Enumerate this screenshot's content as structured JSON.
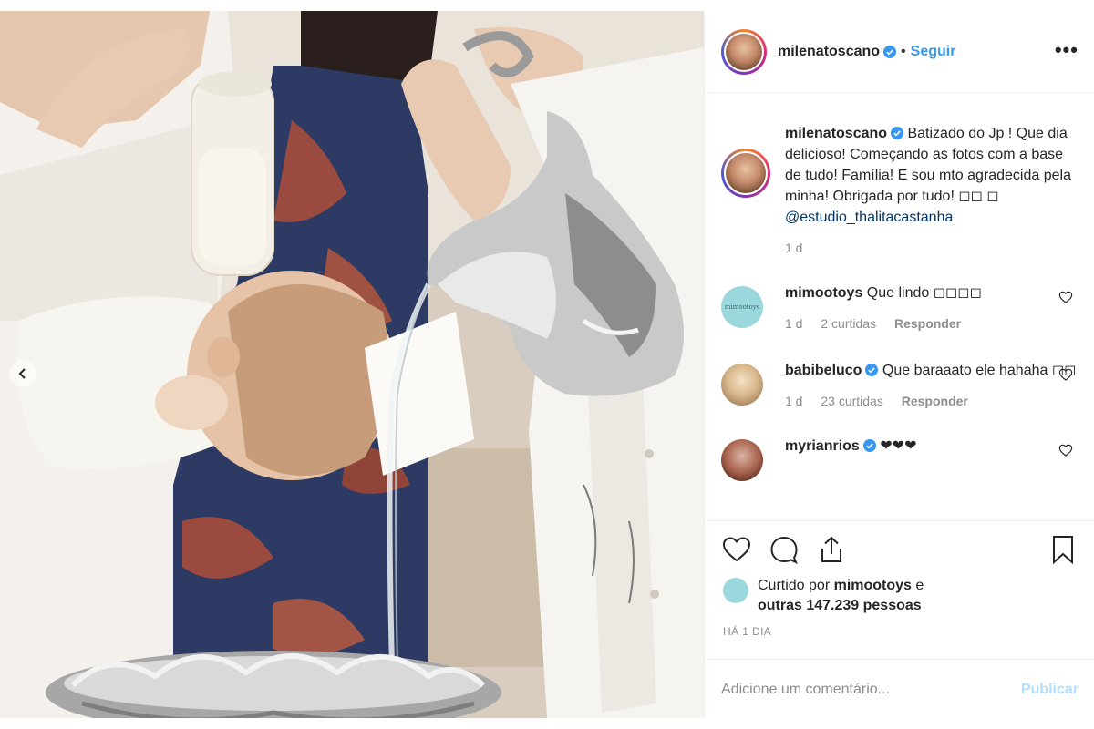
{
  "post": {
    "username": "milenatoscano",
    "separator": "•",
    "follow_label": "Seguir",
    "more_label": "•••"
  },
  "caption": {
    "username": "milenatoscano",
    "text": "Batizado do Jp ! Que dia delicioso! Começando as fotos com a base de tudo! Família! E sou mto agradecida pela minha! Obrigada por tudo! ◻◻ ◻",
    "mention": "@estudio_thalitacastanha",
    "age": "1 d"
  },
  "comments": [
    {
      "username": "mimootoys",
      "verified": false,
      "text": "Que lindo ◻◻◻◻",
      "age": "1 d",
      "likes": "2 curtidas",
      "reply": "Responder",
      "avatar_text": "mimootoys"
    },
    {
      "username": "babibeluco",
      "verified": true,
      "text": "Que baraaato ele hahaha ◻◻",
      "age": "1 d",
      "likes": "23 curtidas",
      "reply": "Responder"
    },
    {
      "username": "myrianrios",
      "verified": true,
      "text": "❤❤❤"
    }
  ],
  "likes": {
    "prefix": "Curtido por",
    "user": "mimootoys",
    "conjunction": "e",
    "others": "outras 147.239 pessoas"
  },
  "time": "HÁ 1 DIA",
  "add_comment": {
    "placeholder": "Adicione um comentário...",
    "publish_label": "Publicar"
  },
  "colors": {
    "link": "#3897f0",
    "mention": "#003569",
    "muted": "#8e8e8e",
    "publish_disabled": "#b2dffc",
    "verified": "#3897f0"
  },
  "icons": [
    "heart-icon",
    "comment-icon",
    "share-icon",
    "bookmark-icon",
    "verified-icon",
    "chevron-left-icon",
    "more-icon"
  ]
}
